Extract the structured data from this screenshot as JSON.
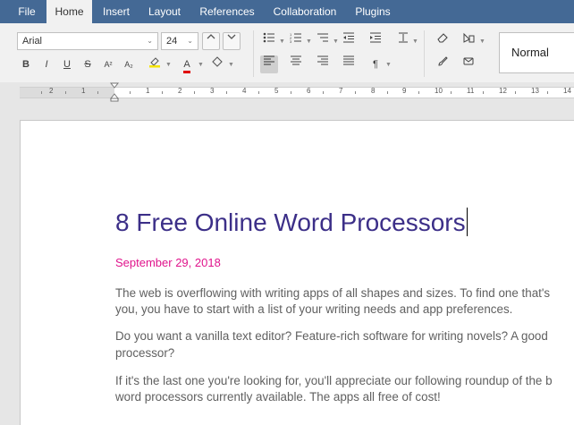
{
  "menu": {
    "tabs": [
      "File",
      "Home",
      "Insert",
      "Layout",
      "References",
      "Collaboration",
      "Plugins"
    ],
    "active": "Home"
  },
  "toolbar": {
    "font_name": "Arial",
    "font_size": "24",
    "style_name": "Normal",
    "bold": "B",
    "italic": "I",
    "underline": "U",
    "strike": "S",
    "superscript": "A²",
    "subscript": "A₂",
    "font_color_glyph": "A",
    "paragraph_mark": "¶"
  },
  "ruler": {
    "numbers": [
      "2",
      "1",
      "1",
      "2",
      "3",
      "4",
      "5",
      "6",
      "7",
      "8",
      "9",
      "10",
      "11",
      "12",
      "13",
      "14"
    ]
  },
  "document": {
    "title": "8 Free Online Word Processors",
    "date": "September 29, 2018",
    "paragraphs": [
      [
        "The web is overflowing with writing apps of all shapes and sizes. To find one that's",
        "you, you have to start with a list of your writing needs and app preferences."
      ],
      [
        "Do you want a vanilla text editor? Feature-rich software for writing novels? A good",
        "processor?"
      ],
      [
        "If it's the last one you're looking for, you'll appreciate our following roundup of the b",
        "word processors currently available. The apps all free of cost!"
      ]
    ]
  },
  "colors": {
    "menubar": "#446995",
    "title": "#3c2f88",
    "date": "#e0148c",
    "body_text": "#606060"
  }
}
